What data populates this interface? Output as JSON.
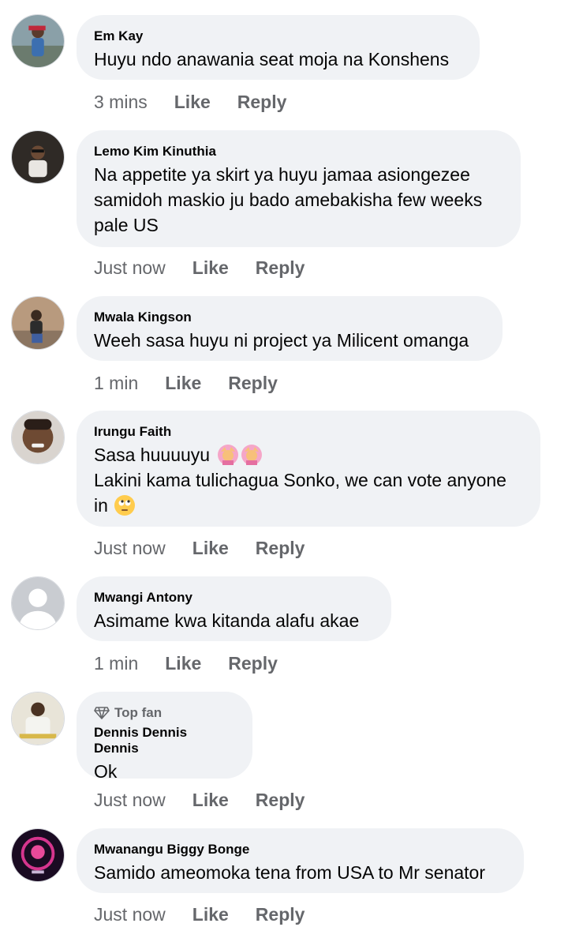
{
  "comments": [
    {
      "author": "Em Kay",
      "lines": [
        "Huyu ndo anawania seat moja na Konshens"
      ],
      "time": "3 mins",
      "like": "Like",
      "reply": "Reply"
    },
    {
      "author": "Lemo Kim Kinuthia",
      "lines": [
        "Na appetite ya skirt ya huyu jamaa asiongezee",
        "samidoh maskio ju bado amebakisha few weeks",
        "pale US"
      ],
      "time": "Just now",
      "like": "Like",
      "reply": "Reply"
    },
    {
      "author": "Mwala Kingson",
      "lines": [
        "Weeh sasa huyu ni project ya Milicent omanga"
      ],
      "time": "1 min",
      "like": "Like",
      "reply": "Reply"
    },
    {
      "author": "Irungu Faith",
      "lines": [
        "Sasa huuuuyu",
        "Lakini kama tulichagua Sonko, we can vote anyone",
        "in"
      ],
      "time": "Just now",
      "like": "Like",
      "reply": "Reply"
    },
    {
      "author": "Mwangi Antony",
      "lines": [
        "Asimame kwa kitanda alafu akae"
      ],
      "time": "1 min",
      "like": "Like",
      "reply": "Reply"
    },
    {
      "badge": "Top fan",
      "author": "Dennis Dennis Dennis",
      "lines": [
        "Ok"
      ],
      "time": "Just now",
      "like": "Like",
      "reply": "Reply"
    },
    {
      "author": "Mwanangu Biggy Bonge",
      "lines": [
        "Samido ameomoka tena from USA to Mr senator"
      ],
      "time": "Just now",
      "like": "Like",
      "reply": "Reply"
    }
  ],
  "icons": {
    "badge": "diamond-icon",
    "emoji_facepalm": "woman-gesturing-ok-emoji",
    "emoji_eyeroll": "eye-roll-emoji"
  },
  "colors": {
    "bubble": "#f0f2f5",
    "secondary_text": "#65676b",
    "primary_text": "#050505"
  }
}
